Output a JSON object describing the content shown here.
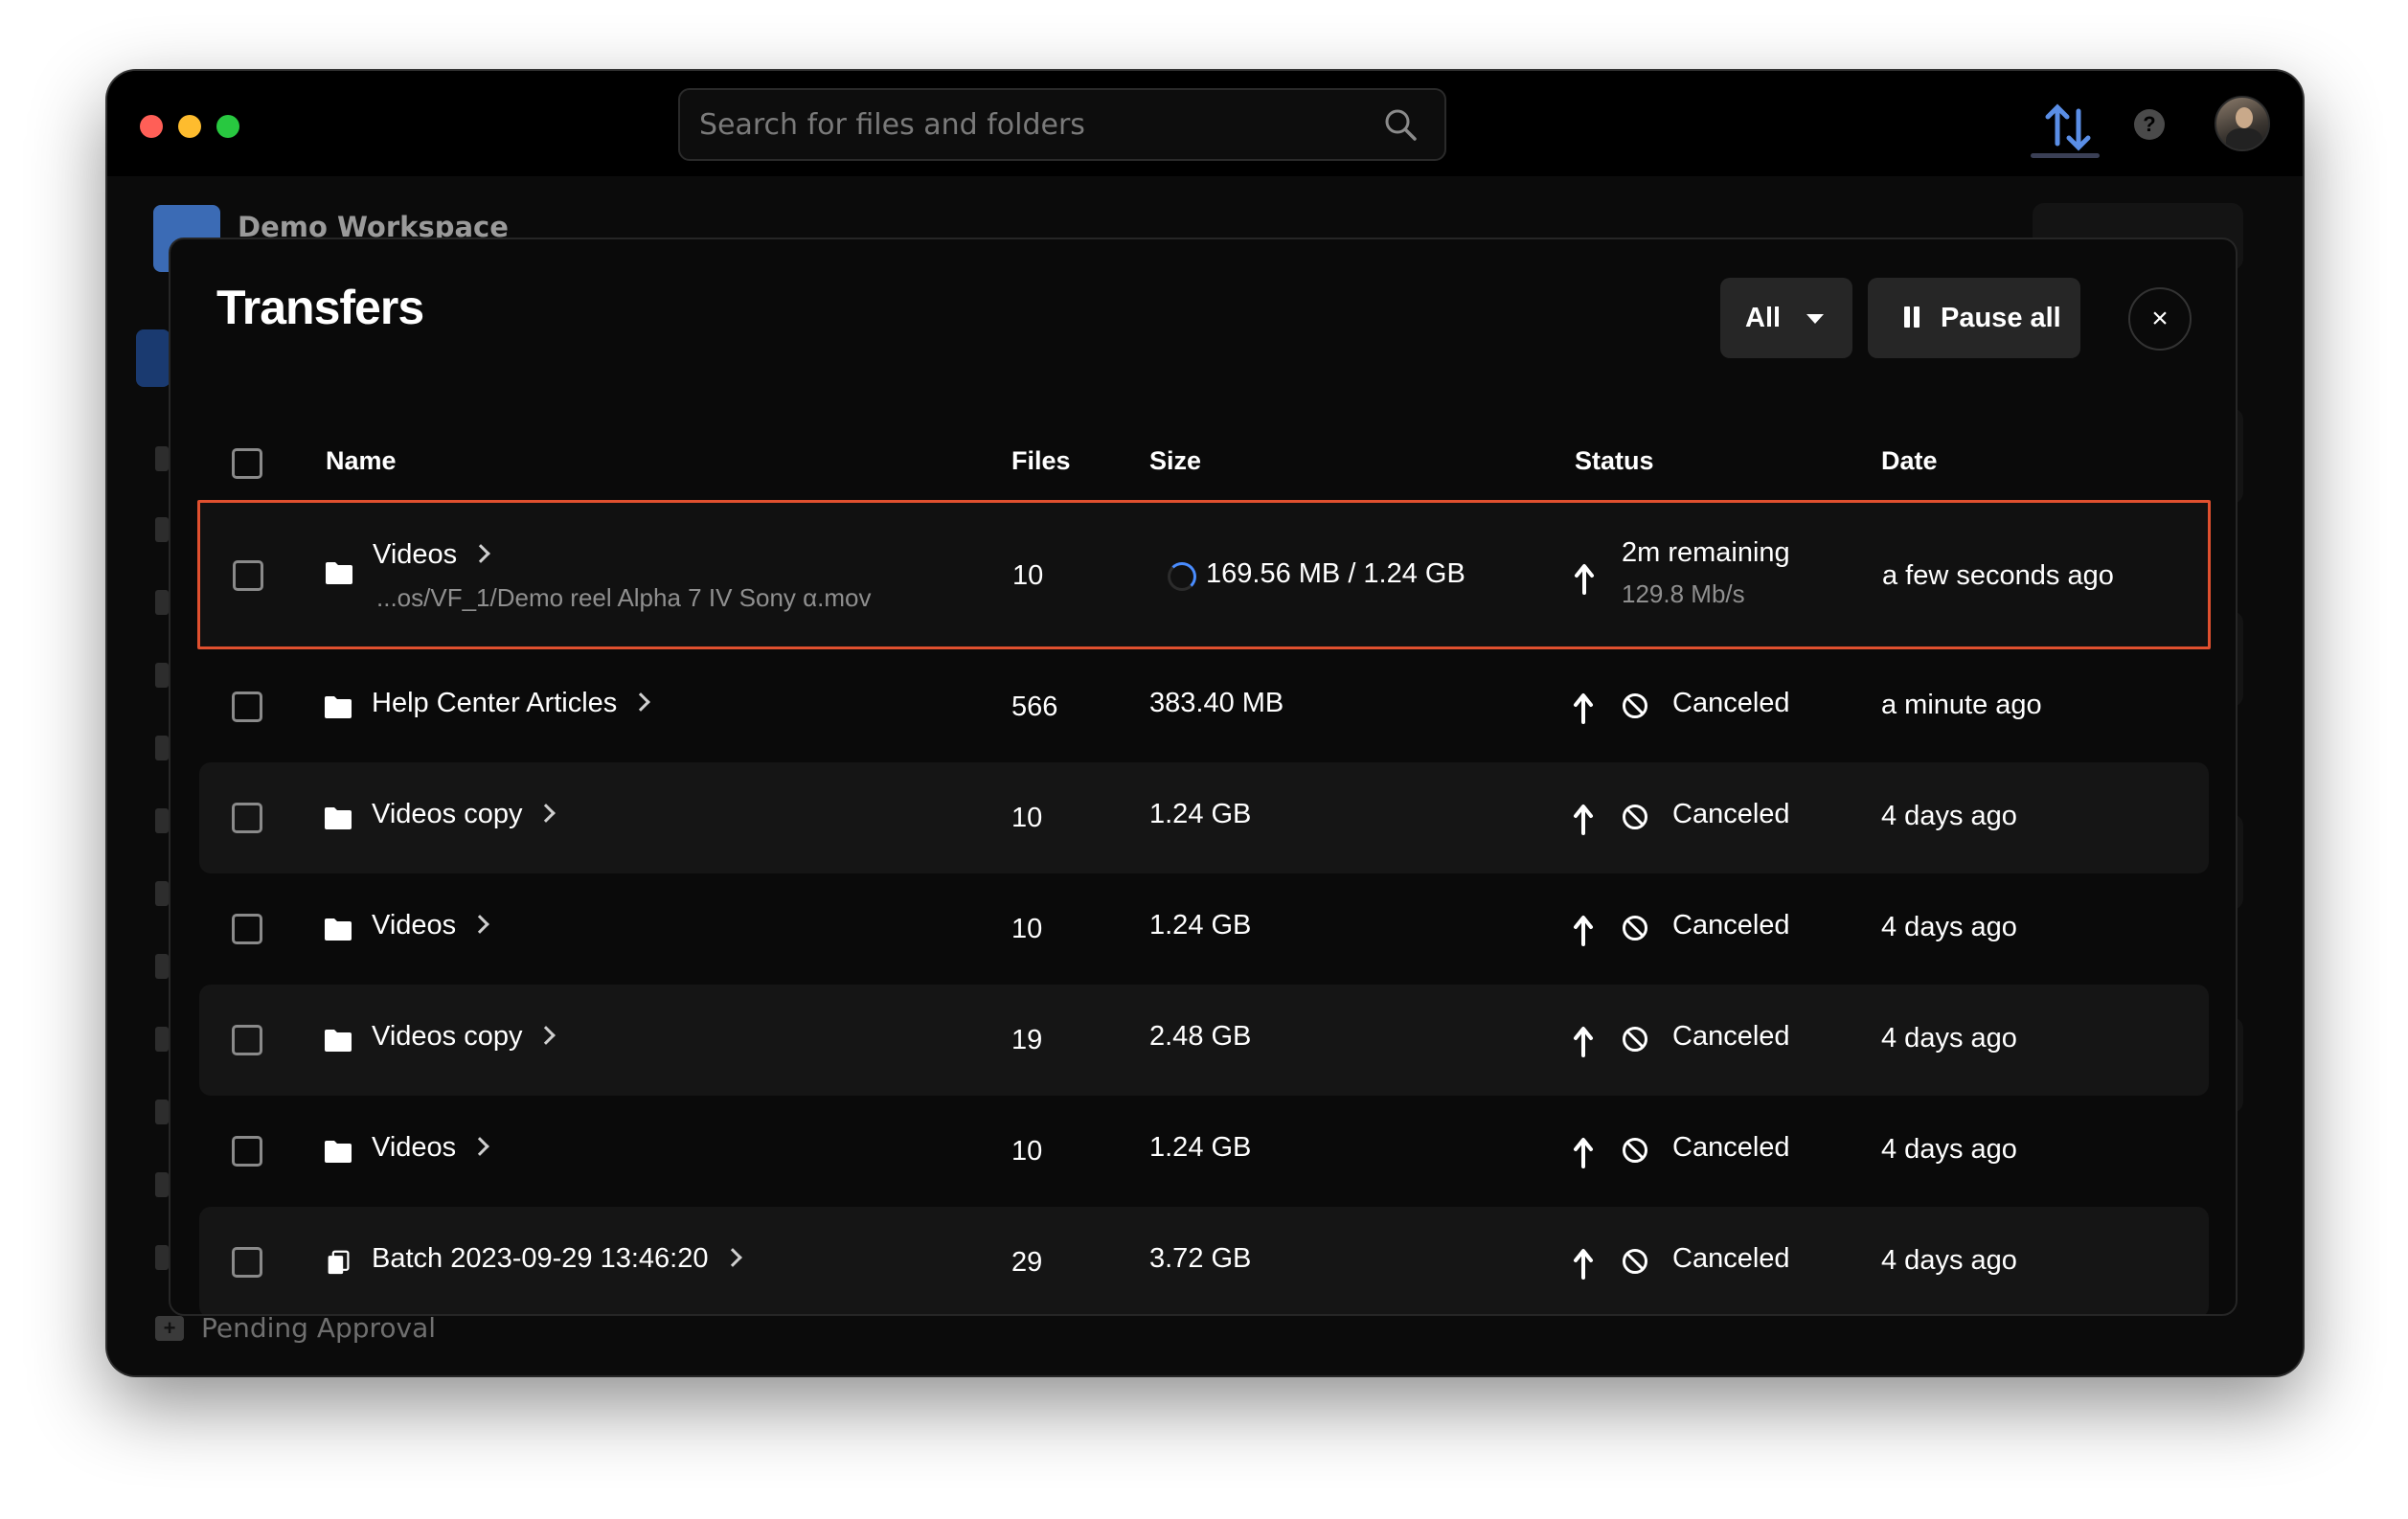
{
  "search": {
    "placeholder": "Search for files and folders"
  },
  "icons": {
    "search": "search-icon",
    "transfers": "up-down-arrows-icon",
    "help": "question-icon",
    "avatar": "user-avatar",
    "folder": "folder-icon",
    "batch": "files-stack-icon",
    "upload": "upload-arrow-icon",
    "canceled": "prohibit-icon",
    "spinner": "loading-spinner-icon"
  },
  "help_label": "?",
  "workspace": {
    "name": "Demo Workspace"
  },
  "sidebar": {
    "pending_label": "Pending Approval"
  },
  "modal": {
    "title": "Transfers",
    "filter_label": "All",
    "pause_label": "Pause all",
    "close_label": "×"
  },
  "columns": {
    "name": "Name",
    "files": "Files",
    "size": "Size",
    "status": "Status",
    "date": "Date"
  },
  "rows": [
    {
      "name": "Videos",
      "path": "...os/VF_1/Demo reel Alpha 7 IV Sony α.mov",
      "files": "10",
      "size": "169.56 MB / 1.24 GB",
      "status": "2m remaining",
      "rate": "129.8 Mb/s",
      "date": "a few seconds ago",
      "icon": "folder"
    },
    {
      "name": "Help Center Articles",
      "files": "566",
      "size": "383.40 MB",
      "status": "Canceled",
      "date": "a minute ago",
      "icon": "folder"
    },
    {
      "name": "Videos copy",
      "files": "10",
      "size": "1.24 GB",
      "status": "Canceled",
      "date": "4 days ago",
      "icon": "folder"
    },
    {
      "name": "Videos",
      "files": "10",
      "size": "1.24 GB",
      "status": "Canceled",
      "date": "4 days ago",
      "icon": "folder"
    },
    {
      "name": "Videos copy",
      "files": "19",
      "size": "2.48 GB",
      "status": "Canceled",
      "date": "4 days ago",
      "icon": "folder"
    },
    {
      "name": "Videos",
      "files": "10",
      "size": "1.24 GB",
      "status": "Canceled",
      "date": "4 days ago",
      "icon": "folder"
    },
    {
      "name": "Batch 2023-09-29 13:46:20",
      "files": "29",
      "size": "3.72 GB",
      "status": "Canceled",
      "date": "4 days ago",
      "icon": "batch"
    }
  ],
  "colors": {
    "accent_border": "#e0502f",
    "spinner": "#4a8dff",
    "background": "#0a0a0a"
  }
}
